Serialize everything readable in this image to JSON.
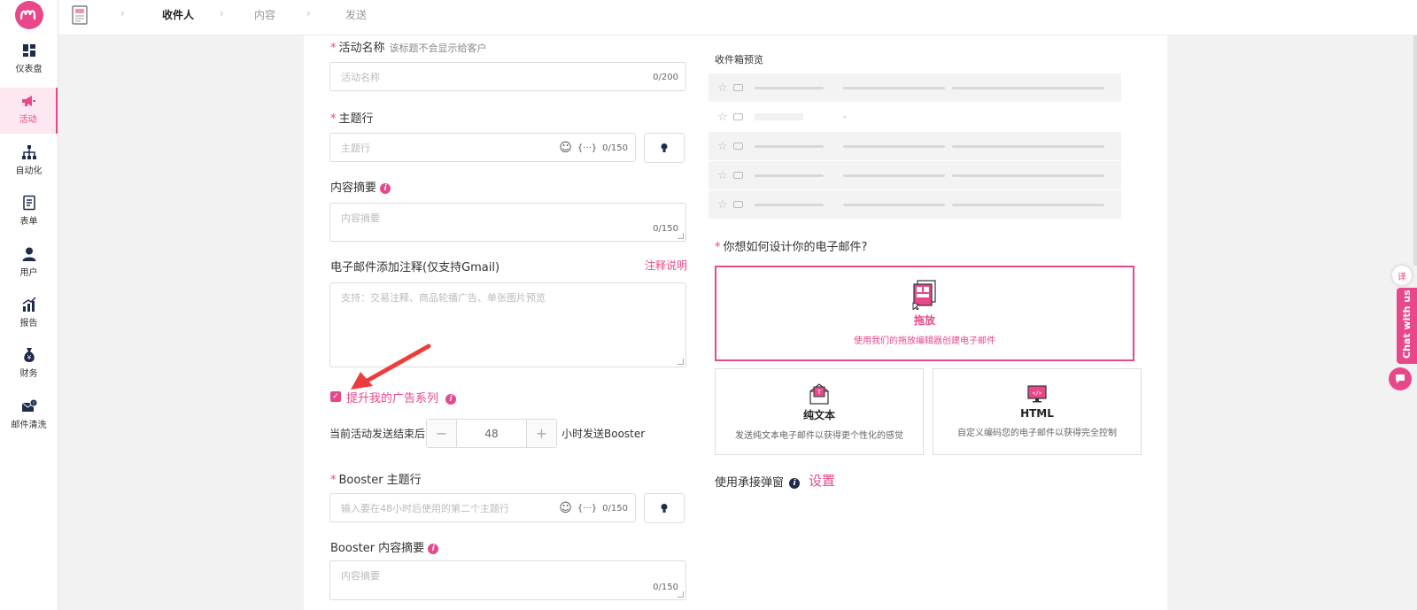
{
  "colors": {
    "accent": "#e8488a",
    "dark": "#1e2b4a"
  },
  "sidebar": {
    "items": [
      {
        "label": "仪表盘",
        "icon": "dashboard-icon"
      },
      {
        "label": "活动",
        "icon": "megaphone-icon",
        "active": true
      },
      {
        "label": "自动化",
        "icon": "hierarchy-icon"
      },
      {
        "label": "表单",
        "icon": "form-icon"
      },
      {
        "label": "用户",
        "icon": "user-icon"
      },
      {
        "label": "报告",
        "icon": "bar-chart-icon"
      },
      {
        "label": "财务",
        "icon": "money-bag-icon"
      },
      {
        "label": "邮件清洗",
        "icon": "mail-clean-icon"
      }
    ]
  },
  "breadcrumb": {
    "steps": [
      "收件人",
      "内容",
      "发送"
    ],
    "active": "收件人"
  },
  "form": {
    "campaign_name": {
      "label": "活动名称",
      "hint": "该标题不会显示给客户",
      "placeholder": "活动名称",
      "count": "0/200"
    },
    "subject": {
      "label": "主题行",
      "placeholder": "主题行",
      "count": "0/150"
    },
    "summary": {
      "label": "内容摘要",
      "placeholder": "内容摘要",
      "count": "0/150"
    },
    "annotation": {
      "label": "电子邮件添加注释(仅支持Gmail)",
      "link": "注释说明",
      "placeholder": "支持：交易注释、商品轮播广告、单张图片预览"
    },
    "booster_toggle": {
      "label": "提升我的广告系列",
      "checked": true
    },
    "booster_delay": {
      "prefix": "当前活动发送结束后",
      "value": "48",
      "suffix": "小时发送Booster",
      "minus": "−",
      "plus": "+"
    },
    "booster_subject": {
      "label": "Booster 主题行",
      "placeholder": "输入要在48小时后使用的第二个主题行",
      "count": "0/150"
    },
    "booster_summary": {
      "label": "Booster 内容摘要",
      "placeholder": "内容摘要",
      "count": "0/150"
    },
    "variables_label": "{···}"
  },
  "preview": {
    "title": "收件箱预览",
    "dash": "-"
  },
  "design": {
    "question": "你想如何设计你的电子邮件?",
    "options": [
      {
        "title": "拖放",
        "desc": "使用我们的拖放编辑器创建电子邮件",
        "selected": true
      },
      {
        "title": "纯文本",
        "desc": "发送纯文本电子邮件以获得更个性化的感觉"
      },
      {
        "title": "HTML",
        "desc": "自定义编码您的电子邮件以获得完全控制"
      }
    ]
  },
  "popup": {
    "label": "使用承接弹窗",
    "link": "设置"
  },
  "widgets": {
    "chat": "Chat with us",
    "translate": "译"
  }
}
